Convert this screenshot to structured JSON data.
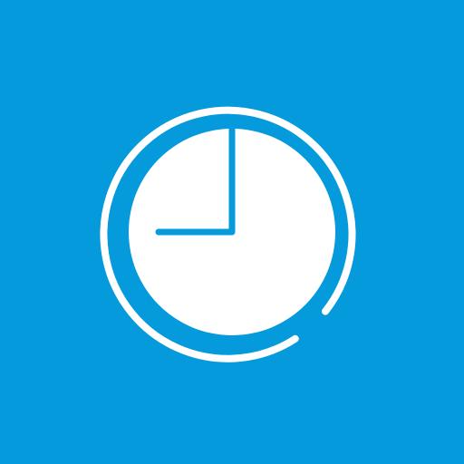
{
  "tile": {
    "icon": "clock-icon",
    "background_color": "#049ADB",
    "foreground_color": "#FFFFFF",
    "hand_color": "#049ADB"
  }
}
